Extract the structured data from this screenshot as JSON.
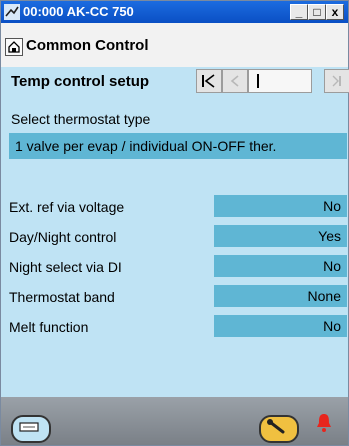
{
  "window": {
    "title": "00:000 AK-CC 750",
    "minimize": "_",
    "maximize": "□",
    "close": "x"
  },
  "header": {
    "title": "Common Control"
  },
  "section": {
    "title": "Temp control setup"
  },
  "thermostat": {
    "label": "Select thermostat type",
    "value": "1 valve per evap / individual ON-OFF ther."
  },
  "params": [
    {
      "label": "Ext. ref via voltage",
      "value": "No"
    },
    {
      "label": "Day/Night control",
      "value": "Yes"
    },
    {
      "label": "Night select via DI",
      "value": "No"
    },
    {
      "label": "Thermostat band",
      "value": "None"
    },
    {
      "label": "Melt function",
      "value": "No"
    }
  ],
  "colors": {
    "titlebar": "#0a4fc4",
    "panel": "#bfe3f4",
    "value_cell": "#5fb6d4",
    "alarm": "#e8251d",
    "tool_button": "#f0c040"
  },
  "icons": [
    "app-icon",
    "home-icon",
    "first-page-icon",
    "previous-page-icon",
    "next-page-icon",
    "last-page-icon",
    "keyboard-icon",
    "wrench-icon",
    "alarm-bell-icon"
  ]
}
